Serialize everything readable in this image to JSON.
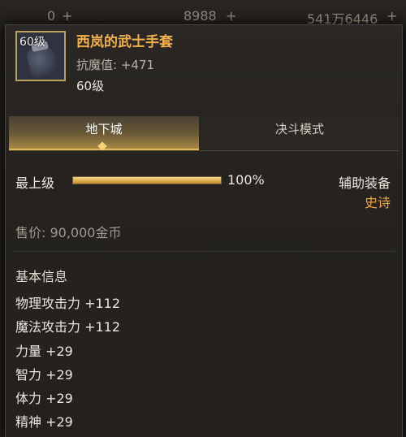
{
  "hud": {
    "val_a": "0",
    "val_b": "8988",
    "val_c": "541万6446",
    "plus": "+"
  },
  "item": {
    "icon_level": "60级",
    "name": "西岚的武士手套",
    "resist_label": "抗魔值:",
    "resist_value": "+471",
    "level": "60级",
    "icon": "gauntlet-icon"
  },
  "tabs": [
    {
      "label": "地下城",
      "active": true
    },
    {
      "label": "决斗模式",
      "active": false
    }
  ],
  "enhance": {
    "max_label": "最上级",
    "progress": 1.0,
    "progress_text": "100%"
  },
  "slot": {
    "type": "辅助装备",
    "rarity": "史诗"
  },
  "price": "售价: 90,000金币",
  "basic_info": {
    "title": "基本信息",
    "stats": [
      "物理攻击力 +112",
      "魔法攻击力 +112",
      "力量 +29",
      "智力 +29",
      "体力 +29",
      "精神 +29"
    ]
  },
  "colors": {
    "item_name": "#f2b24b",
    "rarity": "#f2a93b",
    "accent_gold": "#e3b853"
  }
}
